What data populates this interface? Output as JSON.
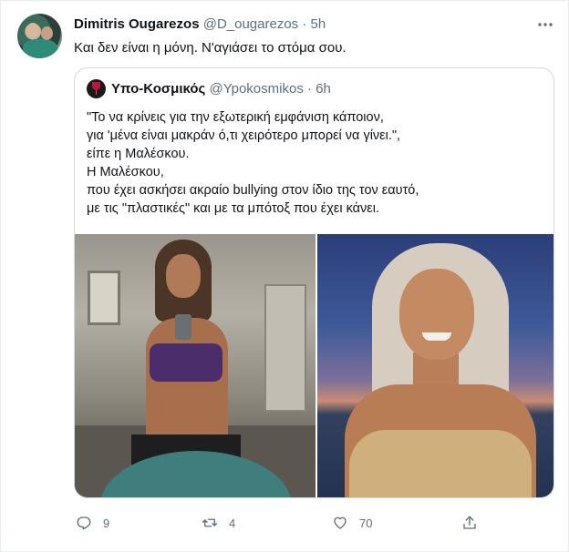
{
  "tweet": {
    "author_name": "Dimitris Ougarezos",
    "author_handle": "@D_ougarezos",
    "separator": "·",
    "time": "5h",
    "text": "Και δεν είναι η μόνη. Ν'αγιάσει το στόμα σου.",
    "more_icon": "more-icon"
  },
  "quote": {
    "author_name": "Υπο-Κοσμικός",
    "author_handle": "@Ypokosmikos",
    "separator": "·",
    "time": "6h",
    "lines": [
      "\"Το να κρίνεις για την εξωτερική εμφάνιση κάποιον,",
      "για 'μένα είναι μακράν ό,τι χειρότερο μπορεί να γίνει.\",",
      "είπε η Μαλέσκου.",
      "Η Μαλέσκου,",
      "που έχει ασκήσει ακραίο bullying στον ίδιο της τον εαυτό,",
      "με τις \"πλαστικές\" και με τα μπότοξ που έχει κάνει."
    ]
  },
  "actions": {
    "reply_count": "9",
    "retweet_count": "4",
    "like_count": "70",
    "icons": [
      "reply-icon",
      "retweet-icon",
      "like-icon",
      "share-icon"
    ]
  },
  "colors": {
    "text_primary": "#0f1419",
    "text_secondary": "#5b7083",
    "border": "#cfd9de"
  }
}
